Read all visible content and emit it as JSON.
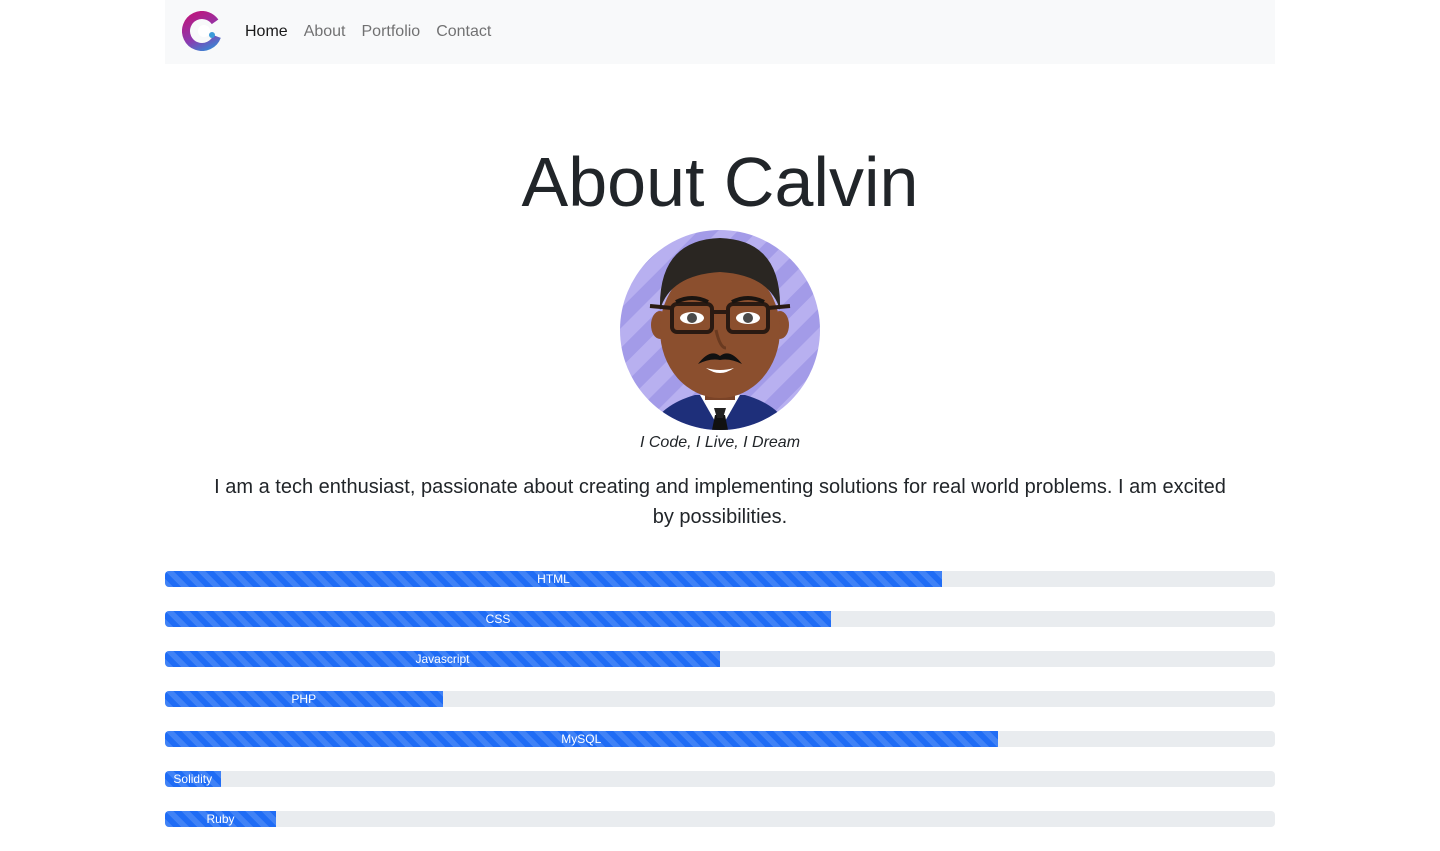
{
  "nav": {
    "logo": "logo-icon",
    "links": [
      "Home",
      "About",
      "Portfolio",
      "Contact"
    ],
    "active": "Home"
  },
  "about": {
    "title": "About Calvin",
    "caption": "I Code, I Live, I Dream",
    "bio": "I am a tech enthusiast, passionate about creating and implementing solutions for real world problems. I am excited by possibilities."
  },
  "skills": [
    {
      "name": "HTML",
      "percent": 70
    },
    {
      "name": "CSS",
      "percent": 60
    },
    {
      "name": "Javascript",
      "percent": 50
    },
    {
      "name": "PHP",
      "percent": 25
    },
    {
      "name": "MySQL",
      "percent": 75
    },
    {
      "name": "Solidity",
      "percent": 5
    },
    {
      "name": "Ruby",
      "percent": 10
    }
  ],
  "colors": {
    "progress_fill": "#1f6cf5",
    "progress_track": "#e9ecef",
    "navbar_bg": "#f8f9fa"
  }
}
